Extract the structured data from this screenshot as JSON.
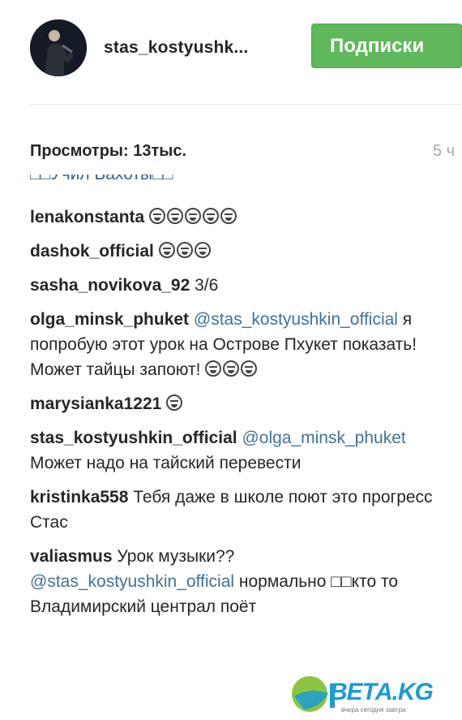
{
  "header": {
    "username": "stas_kostyushk...",
    "follow_label": "Подписки"
  },
  "stats": {
    "views": "Просмотры: 13тыс.",
    "time_ago": "5 ч"
  },
  "comments": {
    "cut_text": "□□Учил Бахоты□□",
    "items": [
      {
        "author": "lenakonstanta",
        "segments": [],
        "emoji_count": 5
      },
      {
        "author": "dashok_official",
        "segments": [],
        "emoji_count": 3
      },
      {
        "author": "sasha_novikova_92",
        "segments": [
          {
            "type": "text",
            "text": " 3/6"
          }
        ],
        "emoji_count": 0
      },
      {
        "author": "olga_minsk_phuket",
        "segments": [
          {
            "type": "mention",
            "text": " @stas_kostyushkin_official"
          },
          {
            "type": "text",
            "text": " я попробую этот урок на Острове Пхукет показать! Может тайцы запоют!"
          }
        ],
        "emoji_count": 3
      },
      {
        "author": "marysianka1221",
        "segments": [],
        "emoji_count": 1
      },
      {
        "author": "stas_kostyushkin_official",
        "segments": [
          {
            "type": "mention",
            "text": " @olga_minsk_phuket"
          },
          {
            "type": "text",
            "text": " Может надо на тайский перевести"
          }
        ],
        "emoji_count": 0
      },
      {
        "author": "kristinka558",
        "segments": [
          {
            "type": "text",
            "text": " Тебя даже в школе поют это прогресс Стас"
          }
        ],
        "emoji_count": 0
      },
      {
        "author": "valiasmus",
        "segments": [
          {
            "type": "text",
            "text": " Урок музыки?? "
          },
          {
            "type": "mention",
            "text": "@stas_kostyushkin_official"
          },
          {
            "type": "text",
            "text": " нормально □□кто то Владимирский централ поёт"
          }
        ],
        "emoji_count": 0
      }
    ]
  },
  "watermark": {
    "brand": "ВЕТА.KG",
    "tagline": "вчера сегодня завтра"
  },
  "colors": {
    "follow_bg": "#5fb95a",
    "mention": "#3f729b",
    "brand": "#1c9bd6"
  }
}
